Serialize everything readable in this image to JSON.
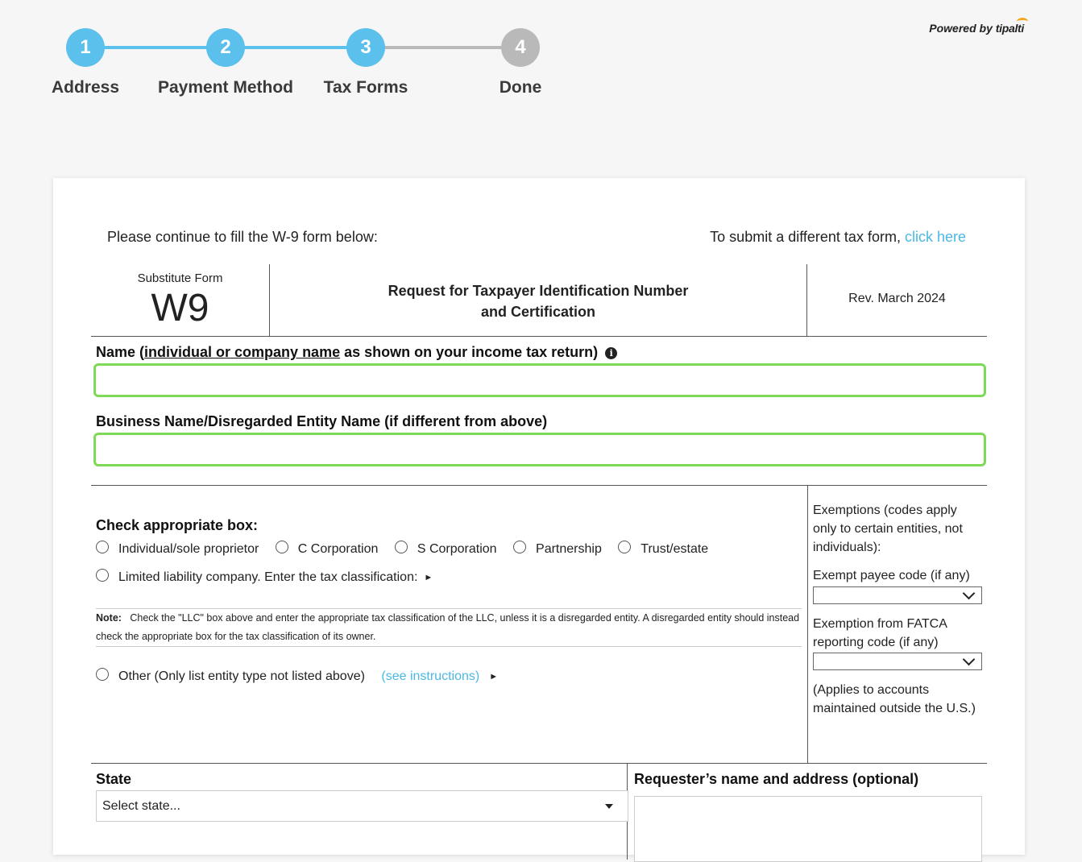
{
  "stepper": {
    "steps": [
      {
        "number": "1",
        "label": "Address",
        "state": "complete"
      },
      {
        "number": "2",
        "label": "Payment Method",
        "state": "complete"
      },
      {
        "number": "3",
        "label": "Tax Forms",
        "state": "current"
      },
      {
        "number": "4",
        "label": "Done",
        "state": "pending"
      }
    ],
    "colors": {
      "active": "#5bc0eb",
      "inactive": "#b9b9b9"
    }
  },
  "powered_by": {
    "prefix": "Powered by",
    "brand": "tipalti"
  },
  "intro": {
    "text": "Please continue to fill the W-9 form below:",
    "alt_prefix": "To submit a different tax form,",
    "alt_link": "click here"
  },
  "form_header": {
    "subtitle": "Substitute Form",
    "form_name": "W9",
    "title_line1": "Request for Taxpayer Identification Number",
    "title_line2": "and Certification",
    "revision": "Rev. March 2024"
  },
  "name_field": {
    "label_prefix": "Name (",
    "label_underlined": "individual or company name",
    "label_suffix": " as shown on your income tax return)",
    "value": ""
  },
  "business_field": {
    "label": "Business Name/Disregarded Entity Name (if different from above)",
    "value": ""
  },
  "classification": {
    "title": "Check appropriate box:",
    "options": [
      "Individual/sole proprietor",
      "C Corporation",
      "S Corporation",
      "Partnership",
      "Trust/estate"
    ],
    "llc_label": "Limited liability company. Enter the tax classification:",
    "note_label": "Note:",
    "note_text": "Check the \"LLC\" box above and enter the appropriate tax classification of the LLC, unless it is a disregarded entity. A disregarded entity should instead check the appropriate box for the tax classification of its owner.",
    "other_label": "Other (Only list entity type not listed above)",
    "other_link": "(see instructions)"
  },
  "exemptions": {
    "intro": "Exemptions (codes apply only to certain entities, not individuals):",
    "payee_label": "Exempt payee code (if any)",
    "payee_value": "",
    "fatca_label": "Exemption from FATCA reporting code (if any)",
    "fatca_value": "",
    "applies_note": "(Applies to accounts maintained outside the U.S.)"
  },
  "state_field": {
    "label": "State",
    "placeholder": "Select state..."
  },
  "requester": {
    "label": "Requester’s name and address (optional)",
    "value": ""
  }
}
